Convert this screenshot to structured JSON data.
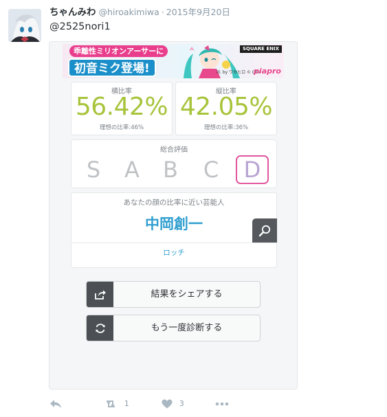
{
  "tweet": {
    "display_name": "ちゃんみわ",
    "handle": "@hiroakimiwa",
    "separator": "·",
    "timestamp": "2015年9月20日",
    "text": "@2525nori1"
  },
  "banner": {
    "top_text": "乖離性ミリオンアーサーに",
    "main_text": "初音ミク登場!",
    "brand": "SQUARE ENIX",
    "credit": "ill. by ワカヒロ © CFM",
    "logo": "piapro"
  },
  "results": {
    "horizontal": {
      "label": "横比率",
      "value": "56.42%",
      "ideal": "理想の比率:46%"
    },
    "vertical": {
      "label": "縦比率",
      "value": "42.05%",
      "ideal": "理想の比率:36%"
    },
    "overall": {
      "title": "総合評価",
      "grades": [
        "S",
        "A",
        "B",
        "C",
        "D"
      ],
      "selected": "D"
    },
    "celebrity": {
      "title": "あなたの顔の比率に近い芸能人",
      "name": "中岡創一",
      "group": "ロッチ"
    }
  },
  "buttons": {
    "share_label": "結果をシェアする",
    "retry_label": "もう一度診断する"
  },
  "actions": {
    "retweet_count": "1",
    "like_count": "3"
  },
  "colors": {
    "ratio_green": "#a7c43b",
    "celebrity_blue": "#2f9ecf",
    "selected_border": "#e2579d",
    "selected_grade": "#b7a3d1",
    "dark_button": "#4c5054"
  }
}
